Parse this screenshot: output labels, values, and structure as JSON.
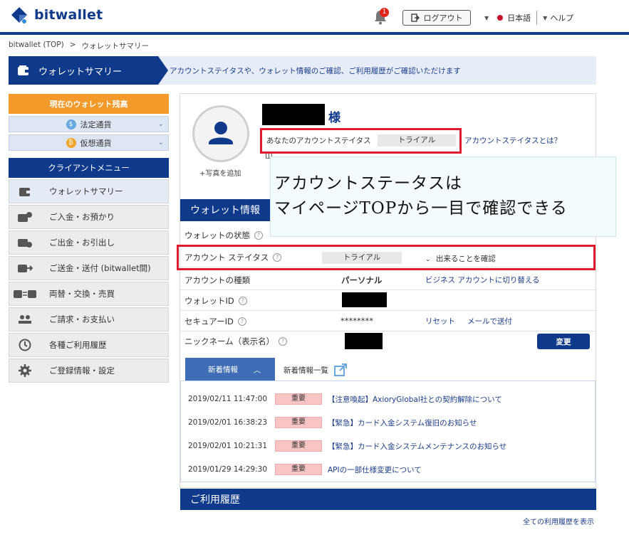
{
  "header": {
    "logo_text": "bitwallet",
    "notification_count": "1",
    "logout_label": "ログアウト",
    "language": "日本語",
    "help_label": "ヘルプ",
    "brand_color": "#0f3a8c"
  },
  "breadcrumb": {
    "home": "bitwallet (TOP)",
    "separator": ">",
    "current": "ウォレットサマリー"
  },
  "banner": {
    "title": "ウォレットサマリー",
    "description": "アカウントステイタスや、ウォレット情報のご確認、ご利用履歴がご確認いただけます"
  },
  "sidebar": {
    "balance_title": "現在のウォレット残高",
    "fiat_label": "法定通貨",
    "crypto_label": "仮想通貨",
    "menu_title": "クライアントメニュー",
    "items": [
      {
        "label": "ウォレットサマリー",
        "icon": "wallet-icon"
      },
      {
        "label": "ご入金・お預かり",
        "icon": "deposit-icon"
      },
      {
        "label": "ご出金・お引出し",
        "icon": "withdraw-icon"
      },
      {
        "label": "ご送金・送付 (bitwallet間)",
        "icon": "transfer-icon"
      },
      {
        "label": "両替・交換・売買",
        "icon": "exchange-icon"
      },
      {
        "label": "ご請求・お支払い",
        "icon": "billing-icon"
      },
      {
        "label": "各種ご利用履歴",
        "icon": "history-icon"
      },
      {
        "label": "ご登録情報・設定",
        "icon": "settings-icon"
      }
    ]
  },
  "profile": {
    "add_photo": "+写真を追加",
    "honorific": "様",
    "status_label": "あなたのアカウントステイタス",
    "status_value": "トライアル",
    "status_help_link": "アカウントステイタスとは？",
    "partial_line": "Ш"
  },
  "callout": {
    "line1": "アカウントステータスは",
    "line2": "マイページTOPから一目で確認できる"
  },
  "wallet": {
    "heading": "ウォレット情報",
    "rows": {
      "state_label": "ウォレットの状態",
      "account_status_label": "アカウント ステイタス",
      "account_status_value": "トライアル",
      "account_status_link": "出来ることを確認",
      "account_type_label": "アカウントの種類",
      "account_type_value": "パーソナル",
      "account_type_link": "ビジネス アカウントに切り替える",
      "wallet_id_label": "ウォレットID",
      "secure_id_label": "セキュアーID",
      "secure_id_value": "********",
      "secure_reset": "リセット",
      "secure_mail": "メールで送付",
      "nickname_label": "ニックネーム（表示名）",
      "change_button": "変更"
    }
  },
  "news": {
    "tab_label": "新着情報",
    "list_link": "新着情報一覧",
    "items": [
      {
        "date": "2019/02/11 11:47:00",
        "badge": "重要",
        "title": "【注意喚起】AxioryGlobal社との契約解除について"
      },
      {
        "date": "2019/02/01 16:38:23",
        "badge": "重要",
        "title": "【緊急】カード入金システム復旧のお知らせ"
      },
      {
        "date": "2019/02/01 10:21:31",
        "badge": "重要",
        "title": "【緊急】カード入金システムメンテナンスのお知らせ"
      },
      {
        "date": "2019/01/29 14:29:30",
        "badge": "重要",
        "title": "APIの一部仕様変更について"
      }
    ]
  },
  "history": {
    "heading": "ご利用履歴",
    "all_link": "全ての利用履歴を表示"
  }
}
